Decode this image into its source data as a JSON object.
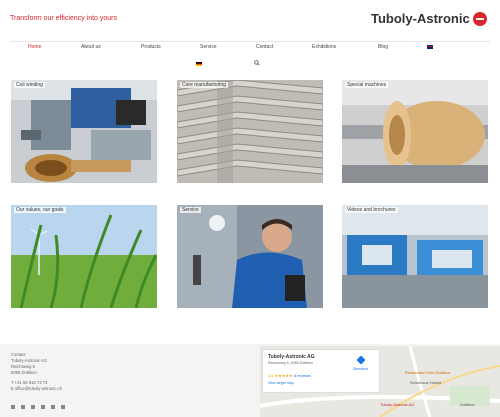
{
  "header": {
    "tagline": "Transform our efficiency into yours",
    "brand": "Tuboly-Astronic"
  },
  "nav": {
    "items": [
      "Home",
      "About us",
      "Products",
      "Service",
      "Contact",
      "Exhibitions",
      "Blog"
    ],
    "active": "Home",
    "lang_current": "",
    "lang_sub": "",
    "lang_current_flag": "flag-uk",
    "lang_sub_flag": "flag-de"
  },
  "tiles": [
    {
      "label": "Coil winding"
    },
    {
      "label": "Core manufacturing"
    },
    {
      "label": "Special machines"
    },
    {
      "label": "Our values, our goals"
    },
    {
      "label": "Service"
    },
    {
      "label": "Videos and brochures"
    }
  ],
  "contact": {
    "title": "Contact",
    "company": "Tuboly-Astronic AG",
    "street": "Reichsweg 5",
    "city": "5085 Dottikon",
    "phone": "T +41 56 616 73 73",
    "email": "E office@tuboly-astronic.ch"
  },
  "map": {
    "name": "Tuboly-Astronic AG",
    "address": "Reichsweg 5, 5085 Dottikon",
    "rating": "4.6 ★★★★★",
    "reviews": "8 reviews",
    "view_larger": "View larger map",
    "directions": "Directions",
    "poi_1": "Restaurant Grün Dottikon",
    "poi_2": "Schulhaus Holzer",
    "poi_3": "Tuboly-Astronic AG",
    "poi_4": "Dottikon"
  },
  "colors": {
    "accent": "#d7262e",
    "footer_bg": "#f4f4f4"
  }
}
